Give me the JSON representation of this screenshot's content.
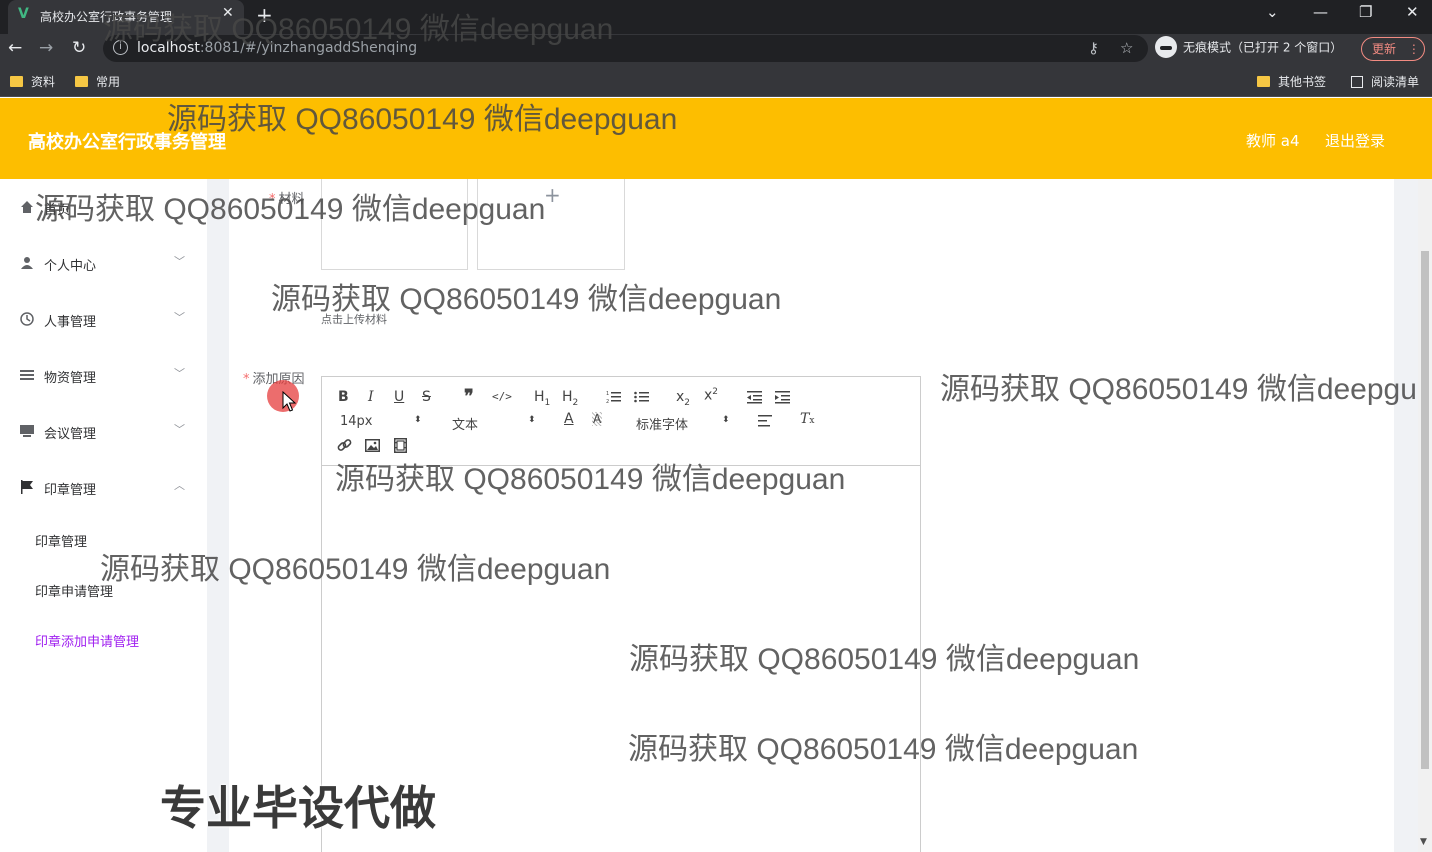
{
  "browser": {
    "tab_title": "高校办公室行政事务管理",
    "tab_favicon": "V",
    "url_host": "localhost",
    "url_rest": ":8081/#/yinzhangaddShenqing",
    "incognito_label": "无痕模式（已打开 2 个窗口）",
    "update_label": "更新",
    "bookmarks": [
      "资料",
      "常用"
    ],
    "other_bookmarks": "其他书签",
    "reading_list": "阅读清单"
  },
  "header": {
    "title": "高校办公室行政事务管理",
    "user": "教师 a4",
    "logout": "退出登录",
    "background_color": "#fdbe00"
  },
  "sidebar": {
    "items": [
      {
        "label": "首页",
        "icon": "home-icon"
      },
      {
        "label": "个人中心",
        "icon": "user-icon"
      },
      {
        "label": "人事管理",
        "icon": "clock-icon"
      },
      {
        "label": "物资管理",
        "icon": "list-icon"
      },
      {
        "label": "会议管理",
        "icon": "monitor-icon"
      },
      {
        "label": "印章管理",
        "icon": "flag-icon"
      }
    ],
    "sub_items": [
      "印章管理",
      "印章申请管理",
      "印章添加申请管理"
    ],
    "active_color": "#a020f0"
  },
  "form": {
    "material_label": "材料",
    "upload_hint": "点击上传材料",
    "reason_label": "添加原因",
    "editor": {
      "font_size": "14px",
      "text_type": "文本",
      "font_family": "标准字体",
      "buttons": [
        "B",
        "I",
        "U",
        "S",
        "❞",
        "</>",
        "H1",
        "H2",
        "ol",
        "ul",
        "x₂",
        "x²",
        "outdent",
        "indent"
      ]
    }
  },
  "watermarks": {
    "text": "源码获取 QQ86050149 微信deepguan",
    "text_cut": "源码获取 QQ86050149 微信deepgu",
    "big": "专业毕设代做"
  }
}
